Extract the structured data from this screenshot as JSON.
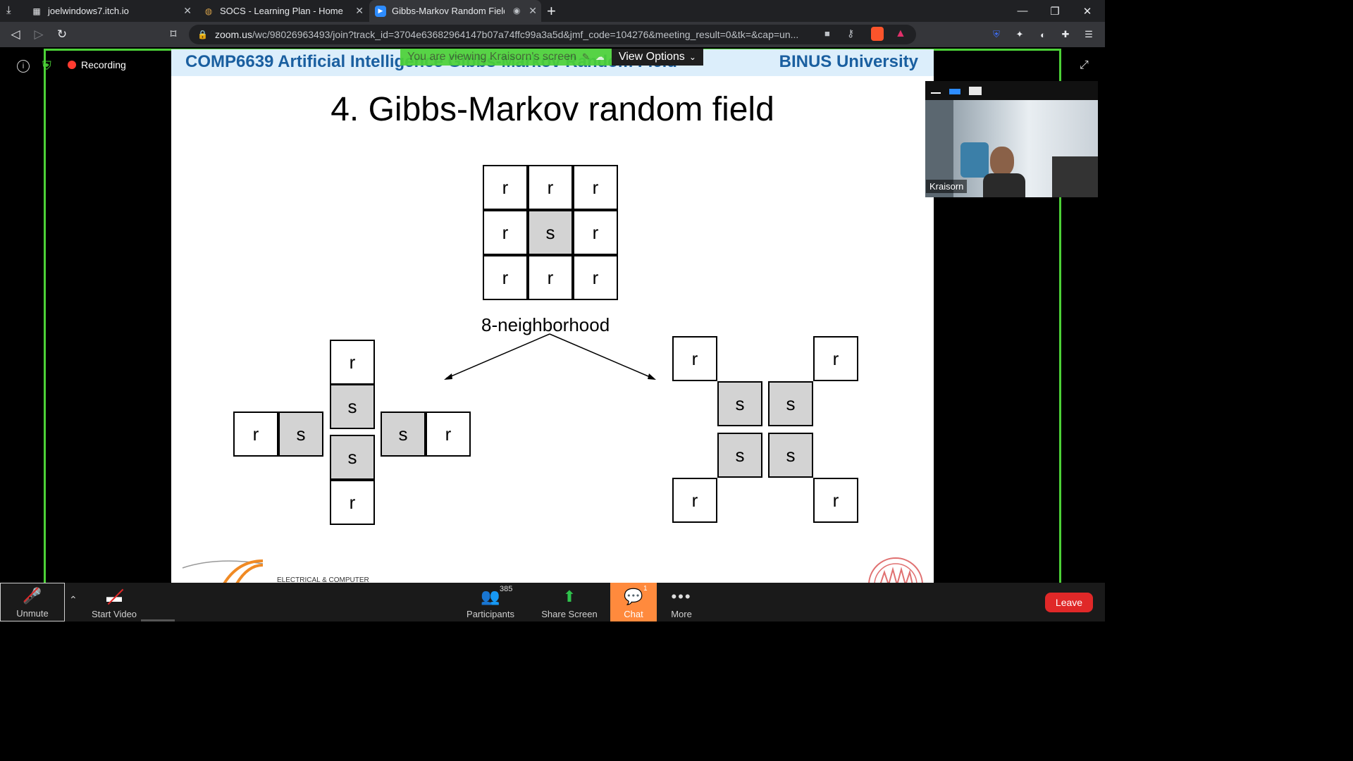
{
  "browser": {
    "tabs": [
      {
        "title": "joelwindows7.itch.io",
        "icon": "itch-icon"
      },
      {
        "title": "SOCS - Learning Plan - Home",
        "icon": "socs-icon"
      },
      {
        "title": "Gibbs-Markov Random Field",
        "icon": "zoom-icon",
        "active": true
      }
    ],
    "url_host": "zoom.us",
    "url_path": "/wc/98026963493/join?track_id=3704e63682964147b07a74ffc99a3a5d&jmf_code=104276&meeting_result=0&tk=&cap=un..."
  },
  "zoom": {
    "recording_label": "Recording",
    "share_banner": "You are viewing Kraisorn's screen",
    "view_options": "View Options",
    "video_name": "Kraisorn",
    "participants_count": "385",
    "chat_badge": "1",
    "buttons": {
      "unmute": "Unmute",
      "start_video": "Start Video",
      "participants": "Participants",
      "share_screen": "Share Screen",
      "chat": "Chat",
      "more": "More",
      "leave": "Leave"
    }
  },
  "slide": {
    "course": "COMP6639 Artificial Intelligence Gibbs-Markov Random Field",
    "university": "BINUS University",
    "title": "4. Gibbs-Markov random field",
    "neighborhood_label": "8-neighborhood",
    "footer_text": "ELECTRICAL & COMPUTER",
    "grid_top": [
      "r",
      "r",
      "r",
      "r",
      "s",
      "r",
      "r",
      "r",
      "r"
    ],
    "cell_r": "r",
    "cell_s": "s"
  },
  "colors": {
    "accent_green": "#4cd137",
    "leave_red": "#e02828",
    "chat_orange": "#ff8a3d",
    "slide_header": "#1a5fa0"
  }
}
